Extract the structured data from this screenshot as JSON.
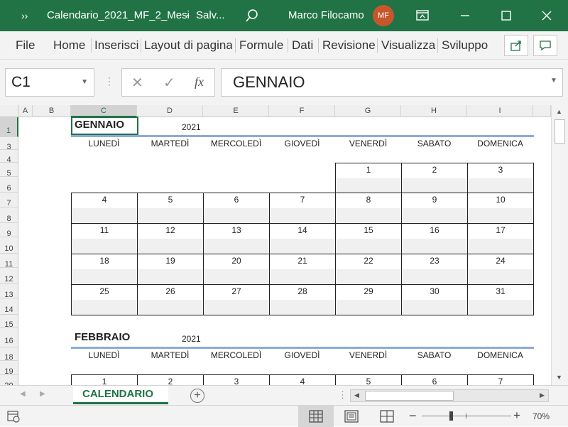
{
  "titlebar": {
    "qat_glyph": "››",
    "filename": "Calendario_2021_MF_2_Mesi",
    "separator": "-",
    "save_status": "Salv...",
    "user_name": "Marco Filocamo",
    "user_initials": "MF",
    "bg_color": "#217346"
  },
  "menu": {
    "items": [
      "File",
      "Home",
      "Inserisci",
      "Layout di pagina",
      "Formule",
      "Dati",
      "Revisione",
      "Visualizza",
      "Sviluppo"
    ]
  },
  "formula_bar": {
    "name_box": "C1",
    "fx_label": "fx",
    "content": "GENNAIO"
  },
  "columns": [
    "A",
    "B",
    "C",
    "D",
    "E",
    "F",
    "G",
    "H",
    "I"
  ],
  "rows": [
    "1",
    "3",
    "4",
    "5",
    "6",
    "7",
    "8",
    "9",
    "10",
    "11",
    "12",
    "13",
    "14",
    "15",
    "16",
    "18",
    "19",
    "20"
  ],
  "weekdays": [
    "LUNEDÌ",
    "MARTEDÌ",
    "MERCOLEDÌ",
    "GIOVEDÌ",
    "VENERDÌ",
    "SABATO",
    "DOMENICA"
  ],
  "january": {
    "month": "GENNAIO",
    "year": "2021",
    "weeks": [
      [
        "",
        "",
        "",
        "",
        "1",
        "2",
        "3"
      ],
      [
        "4",
        "5",
        "6",
        "7",
        "8",
        "9",
        "10"
      ],
      [
        "11",
        "12",
        "13",
        "14",
        "15",
        "16",
        "17"
      ],
      [
        "18",
        "19",
        "20",
        "21",
        "22",
        "23",
        "24"
      ],
      [
        "25",
        "26",
        "27",
        "28",
        "29",
        "30",
        "31"
      ]
    ]
  },
  "february": {
    "month": "FEBBRAIO",
    "year": "2021",
    "first_week": [
      "1",
      "2",
      "3",
      "4",
      "5",
      "6",
      "7"
    ]
  },
  "sheet_tab": "CALENDARIO",
  "status": {
    "zoom": "70%"
  },
  "colors": {
    "accent": "#217346",
    "month_underline": "#8ea9db"
  }
}
